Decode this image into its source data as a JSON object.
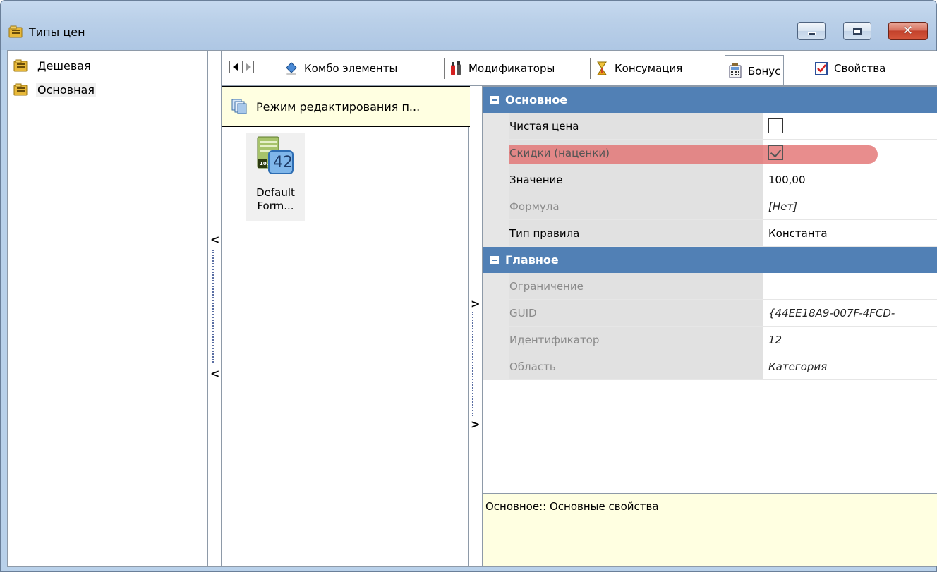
{
  "window": {
    "title": "Типы цен",
    "icon": "folder-list-icon",
    "controls": {
      "minimize": "minimize-icon",
      "maximize": "maximize-icon",
      "close": "close-icon",
      "close_glyph": "✕"
    }
  },
  "tree": {
    "items": [
      {
        "label": "Дешевая",
        "icon": "folder-list-icon",
        "selected": false
      },
      {
        "label": "Основная",
        "icon": "folder-list-icon",
        "selected": true
      }
    ]
  },
  "tabs": [
    {
      "label": "Комбо элементы",
      "icon": "combo-elements-icon",
      "active": false
    },
    {
      "label": "Модификаторы",
      "icon": "modifiers-icon",
      "active": false
    },
    {
      "label": "Консумация",
      "icon": "consumption-icon",
      "active": false
    },
    {
      "label": "Бонус",
      "icon": "bonus-calculator-icon",
      "active": true
    },
    {
      "label": "Свойства",
      "icon": "properties-checklist-icon",
      "active": false
    }
  ],
  "list_panel": {
    "header": "Режим редактирования п...",
    "items": [
      {
        "label": "Default Form...",
        "badge": "42",
        "badge_prefix": "10."
      }
    ]
  },
  "property_grid": {
    "categories": [
      {
        "title": "Основное",
        "rows": [
          {
            "name": "Чистая цена",
            "type": "checkbox",
            "checked": false,
            "disabled": false
          },
          {
            "name": "Скидки (наценки)",
            "type": "checkbox",
            "checked": true,
            "disabled": false,
            "highlighted": true
          },
          {
            "name": "Значение",
            "type": "text",
            "value": "100,00",
            "disabled": false
          },
          {
            "name": "Формула",
            "type": "text",
            "value": "[Нет]",
            "disabled": true
          },
          {
            "name": "Тип правила",
            "type": "text",
            "value": "Константа",
            "disabled": false
          }
        ]
      },
      {
        "title": "Главное",
        "rows": [
          {
            "name": "Ограничение",
            "type": "text",
            "value": "",
            "disabled": true
          },
          {
            "name": "GUID",
            "type": "text",
            "value": "{44EE18A9-007F-4FCD-",
            "disabled": true
          },
          {
            "name": "Идентификатор",
            "type": "text",
            "value": "12",
            "disabled": true
          },
          {
            "name": "Область",
            "type": "text",
            "value": "Категория",
            "disabled": true
          }
        ]
      }
    ],
    "description": "Основное:: Основные свойства"
  },
  "splitters": {
    "left_collapse": "<",
    "right_expand": ">"
  },
  "colors": {
    "category_header": "#5180b5",
    "highlight": "#e26d6d",
    "info_background": "#ffffe1"
  }
}
